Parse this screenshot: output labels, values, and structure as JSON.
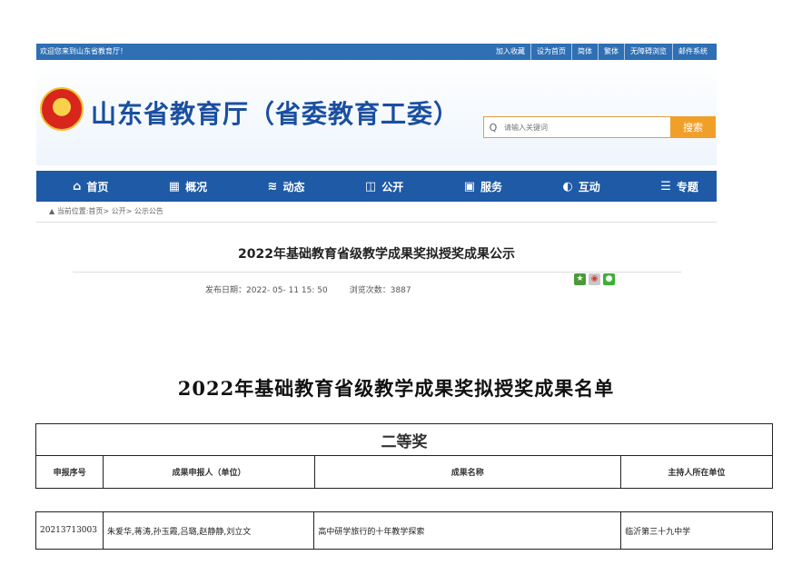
{
  "topbar": {
    "welcome": "欢迎您来到山东省教育厅！",
    "links": [
      "加入收藏",
      "设为首页",
      "简体",
      "繁体",
      "无障碍浏览",
      "邮件系统"
    ]
  },
  "site_title": "山东省教育厅（省委教育工委）",
  "search": {
    "placeholder": "请输入关键词",
    "button": "搜索"
  },
  "nav": [
    {
      "label": "首页",
      "icon": "home-icon",
      "glyph": "⌂"
    },
    {
      "label": "概况",
      "icon": "building-icon",
      "glyph": "▦"
    },
    {
      "label": "动态",
      "icon": "stack-icon",
      "glyph": "≋"
    },
    {
      "label": "公开",
      "icon": "book-icon",
      "glyph": "◫"
    },
    {
      "label": "服务",
      "icon": "service-icon",
      "glyph": "▣"
    },
    {
      "label": "互动",
      "icon": "chat-icon",
      "glyph": "◐"
    },
    {
      "label": "专题",
      "icon": "document-icon",
      "glyph": "☰"
    }
  ],
  "breadcrumb": "当前位置:首页> 公开> 公示公告",
  "article": {
    "title": "2022年基础教育省级教学成果奖拟授奖成果公示",
    "publish_label": "发布日期：",
    "publish_date": "2022- 05- 11 15: 50",
    "views_label": "浏览次数：",
    "views": "3887"
  },
  "document": {
    "title": "2022年基础教育省级教学成果奖拟授奖成果名单",
    "prize": "二等奖",
    "columns": [
      "申报序号",
      "成果申报人（单位）",
      "成果名称",
      "主持人所在单位"
    ],
    "rows": [
      [
        "20213713003",
        "朱爱华,蒋涛,孙玉霞,吕璐,赵静静,刘立文",
        "高中研学旅行的十年教学探索",
        "临沂第三十九中学"
      ]
    ]
  },
  "colors": {
    "brand_blue": "#1e5aa6",
    "title_blue": "#1a4fa0",
    "search_orange": "#f0a028"
  }
}
